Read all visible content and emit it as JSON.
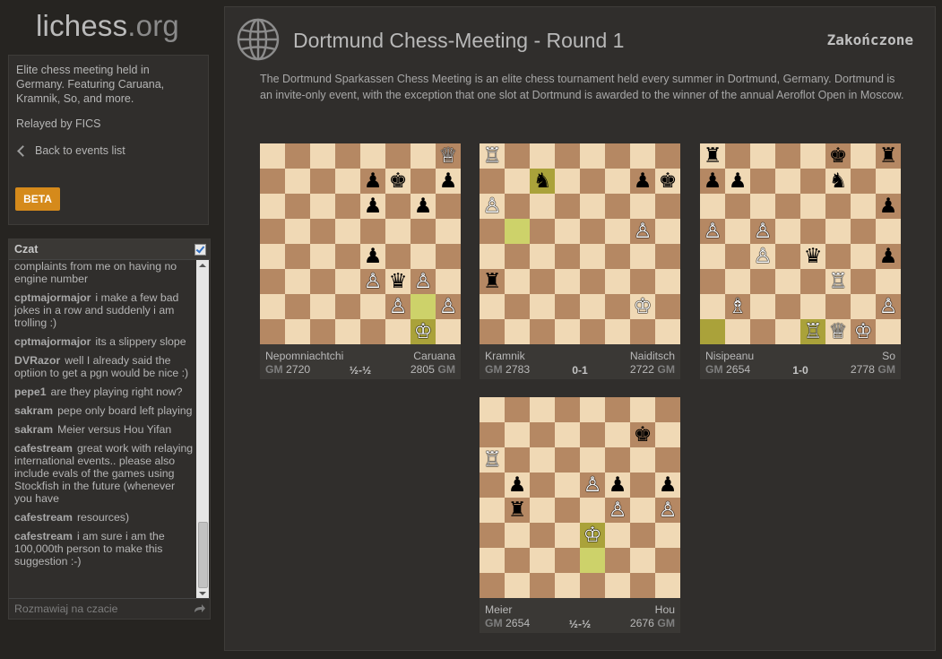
{
  "logo": {
    "main": "lichess",
    "ext": ".org"
  },
  "sidebar": {
    "description": "Elite chess meeting held in Germany. Featuring Caruana, Kramnik, So, and more.",
    "relayed": "Relayed by FICS",
    "back_label": "Back to events list",
    "beta_label": "BETA"
  },
  "chat": {
    "title": "Czat",
    "placeholder": "Rozmawiaj na czacie",
    "messages": [
      {
        "user": "",
        "text": "complaints from me on having no engine number"
      },
      {
        "user": "cptmajormajor",
        "text": "i make a few bad jokes in a row and suddenly i am trolling :)"
      },
      {
        "user": "cptmajormajor",
        "text": "its a slippery slope"
      },
      {
        "user": "DVRazor",
        "text": "well I already said the optiion to get a pgn would be nice :)"
      },
      {
        "user": "pepe1",
        "text": "are they playing right now?"
      },
      {
        "user": "sakram",
        "text": "pepe only board left playing"
      },
      {
        "user": "sakram",
        "text": "Meier versus Hou Yifan"
      },
      {
        "user": "cafestream",
        "text": "great work with relaying international events.. please also include evals of the games using Stockfish in the future (whenever you have"
      },
      {
        "user": "cafestream",
        "text": "resources)"
      },
      {
        "user": "cafestream",
        "text": "i am sure i am the 100,000th person to make this suggestion :-)"
      }
    ]
  },
  "event": {
    "title": "Dortmund Chess-Meeting - Round 1",
    "status": "Zakończone",
    "description": "The Dortmund Sparkassen Chess Meeting is an elite chess tournament held every summer in Dortmund, Germany. Dortmund is an invite-only event, with the exception that one slot at Dortmund is awarded to the winner of the annual Aeroflot Open in Moscow."
  },
  "games": [
    {
      "white": {
        "title": "",
        "name": "Nepomniachtchi",
        "rating": "GM 2720"
      },
      "black": {
        "title": "GM",
        "name": "Caruana",
        "rating": "2805"
      },
      "result": "½-½",
      "board": [
        "-------Q",
        "----pk-p",
        "----p-p-",
        "--------",
        "----p---",
        "----PqP-",
        "-----P-P",
        "------K-"
      ],
      "highlights": [
        [
          6,
          6
        ],
        [
          7,
          6
        ]
      ]
    },
    {
      "white": {
        "title": "",
        "name": "Kramnik",
        "rating": "GM 2783"
      },
      "black": {
        "title": "GM",
        "name": "Naiditsch",
        "rating": "2722"
      },
      "result": "0-1",
      "board": [
        "R-------",
        "--n---pk",
        "P-------",
        "------P-",
        "--------",
        "r-------",
        "------K-",
        "--------"
      ],
      "highlights": [
        [
          1,
          2
        ],
        [
          3,
          1
        ]
      ]
    },
    {
      "white": {
        "title": "",
        "name": "Nisipeanu",
        "rating": "GM 2654"
      },
      "black": {
        "title": "GM",
        "name": "So",
        "rating": "2778"
      },
      "result": "1-0",
      "board": [
        "r----k-r",
        "pp---n--",
        "-------p",
        "P-P-----",
        "--P-q--p",
        "-----R--",
        "-B-----P",
        "----RQK-"
      ],
      "highlights": [
        [
          7,
          0
        ],
        [
          7,
          4
        ]
      ]
    },
    {
      "white": {
        "title": "",
        "name": "Meier",
        "rating": "GM 2654"
      },
      "black": {
        "title": "GM",
        "name": "Hou",
        "rating": "2676"
      },
      "result": "½-½",
      "board": [
        "--------",
        "------k-",
        "R-------",
        "-p--Pp-p",
        "-r---P-P",
        "----K---",
        "--------",
        "--------"
      ],
      "highlights": [
        [
          5,
          4
        ],
        [
          6,
          4
        ]
      ]
    }
  ]
}
